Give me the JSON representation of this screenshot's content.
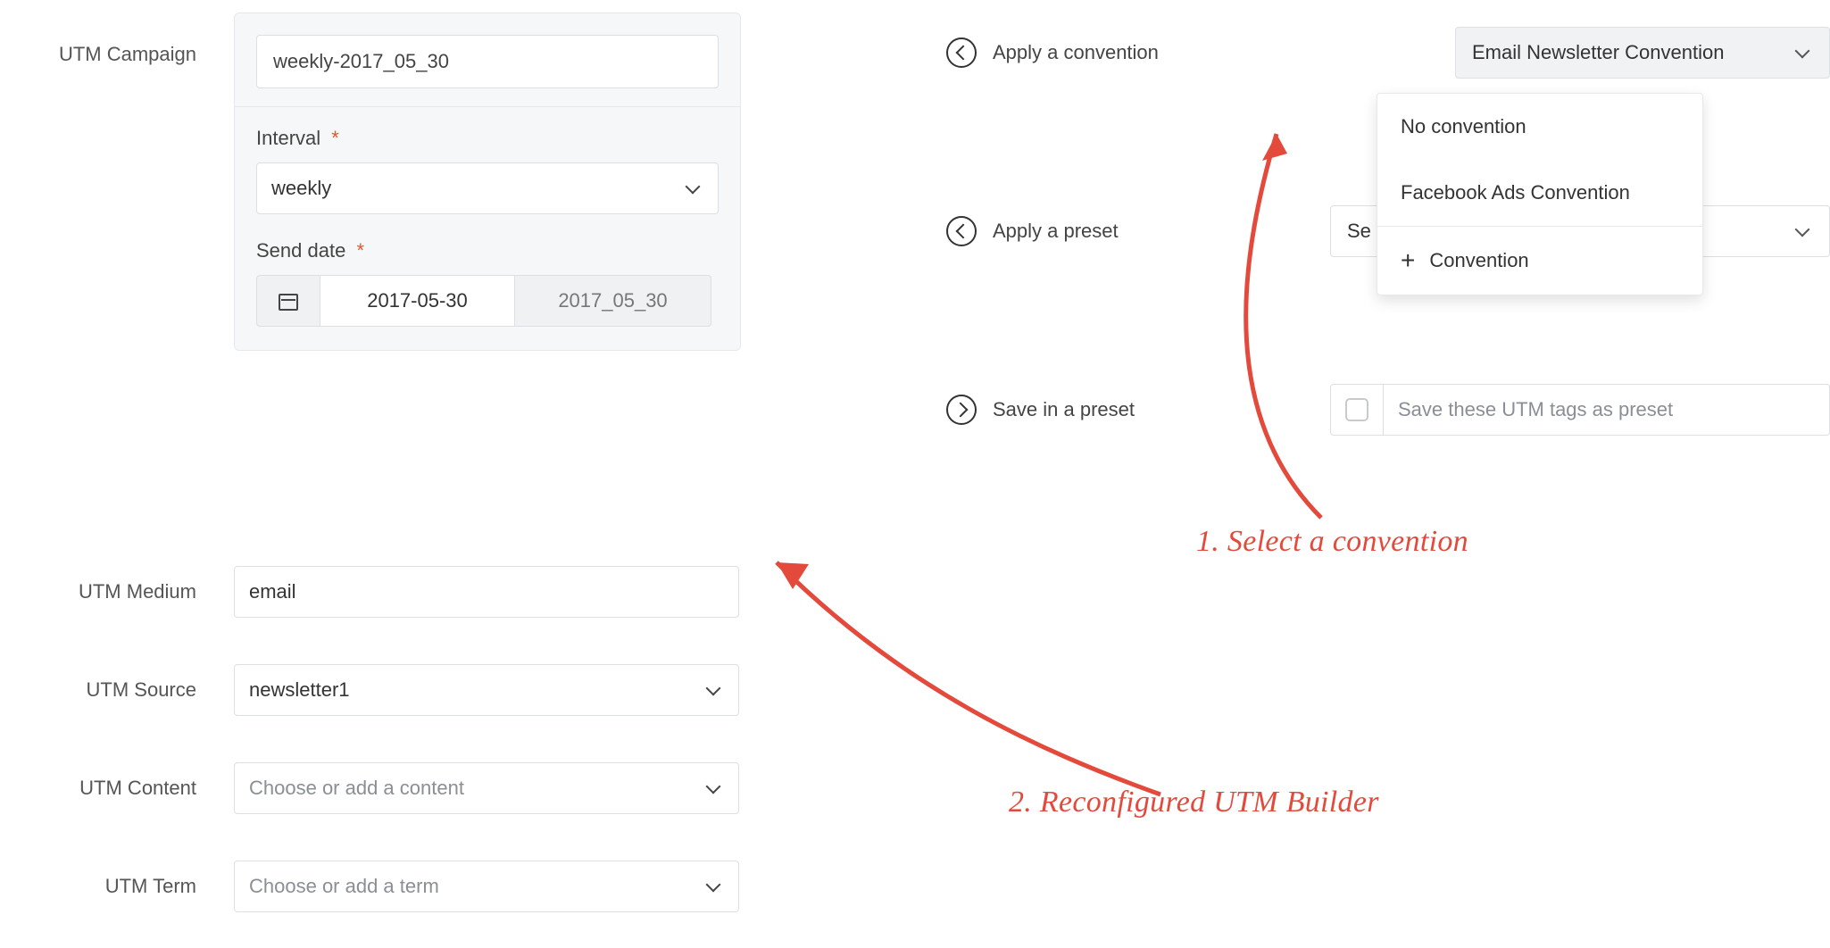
{
  "left": {
    "utm_campaign_label": "UTM Campaign",
    "campaign_value": "weekly-2017_05_30",
    "interval_label": "Interval",
    "required_marker": "*",
    "interval_value": "weekly",
    "send_date_label": "Send date",
    "send_date_value": "2017-05-30",
    "send_date_display": "2017_05_30",
    "utm_medium_label": "UTM Medium",
    "utm_medium_value": "email",
    "utm_source_label": "UTM Source",
    "utm_source_value": "newsletter1",
    "utm_content_label": "UTM Content",
    "utm_content_placeholder": "Choose or add a content",
    "utm_term_label": "UTM Term",
    "utm_term_placeholder": "Choose or add a term"
  },
  "right": {
    "apply_convention_label": "Apply a convention",
    "apply_convention_value": "Email Newsletter Convention",
    "menu": {
      "no_convention": "No convention",
      "fb_ads": "Facebook Ads Convention",
      "add_label": "Convention"
    },
    "apply_preset_label": "Apply a preset",
    "apply_preset_value_partial": "Se",
    "save_preset_label": "Save in a preset",
    "save_preset_placeholder": "Save these UTM tags as preset"
  },
  "annotations": {
    "step1": "1. Select a convention",
    "step2": "2. Reconfigured UTM Builder"
  }
}
